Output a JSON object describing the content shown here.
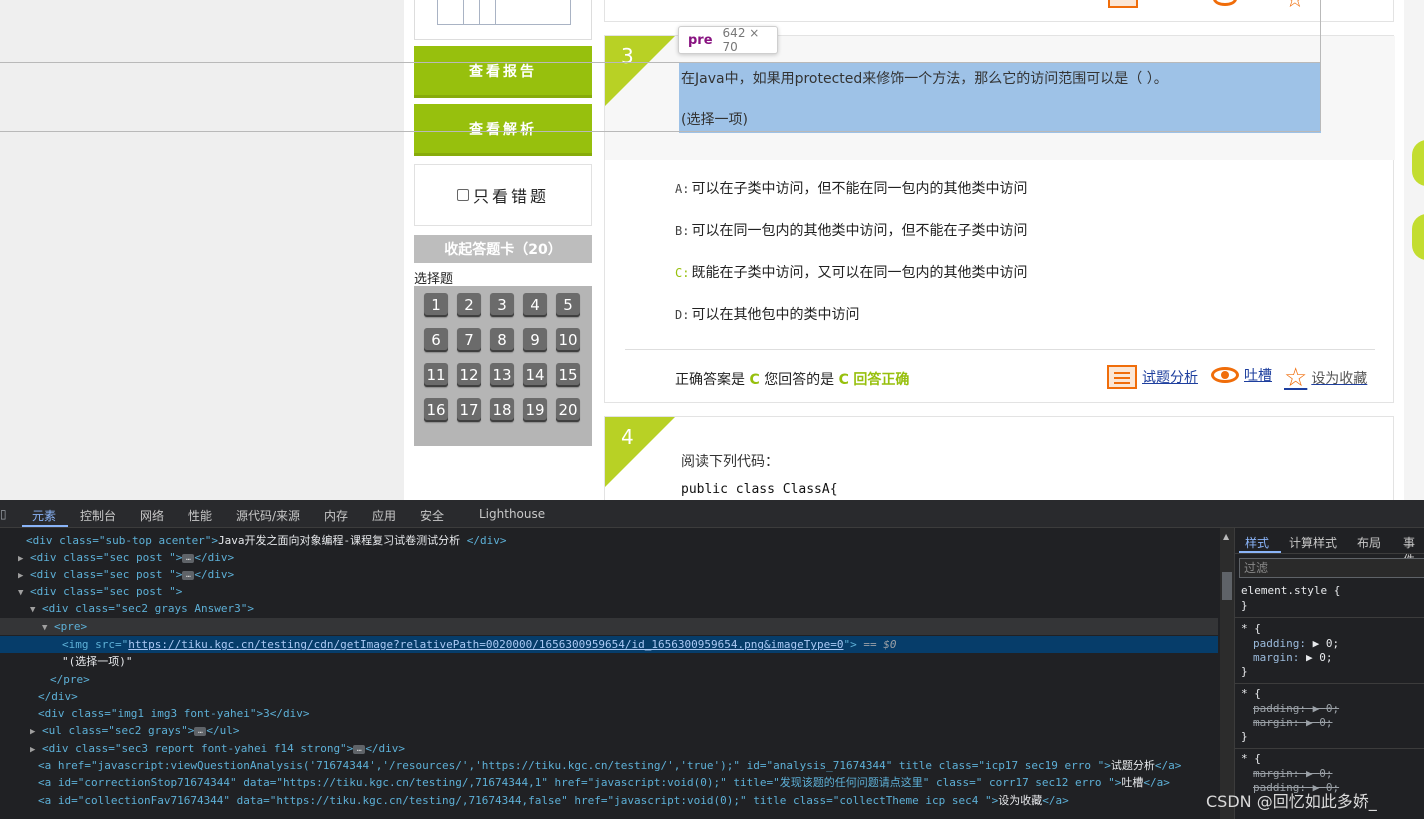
{
  "sidebar": {
    "view_report": "查看报告",
    "view_analysis": "查看解析",
    "only_wrong": "只看错题",
    "collapse_card": "收起答题卡（20）",
    "question_type": "选择题",
    "numbers": [
      "1",
      "2",
      "3",
      "4",
      "5",
      "6",
      "7",
      "8",
      "9",
      "10",
      "11",
      "12",
      "13",
      "14",
      "15",
      "16",
      "17",
      "18",
      "19",
      "20"
    ]
  },
  "inspector_tooltip": {
    "tag": "pre",
    "size": "642 × 70"
  },
  "question3": {
    "number": "3",
    "text": "在Java中，如果用protected来修饰一个方法，那么它的访问范围可以是（ ）。",
    "type_hint": "(选择一项)",
    "options": [
      {
        "key": "A:",
        "text": "可以在子类中访问，但不能在同一包内的其他类中访问"
      },
      {
        "key": "B:",
        "text": "可以在同一包内的其他类中访问，但不能在子类中访问"
      },
      {
        "key": "C:",
        "text": "既能在子类中访问，又可以在同一包内的其他类中访问"
      },
      {
        "key": "D:",
        "text": "可以在其他包中的类中访问"
      }
    ],
    "answer_prefix": "正确答案是",
    "correct_answer": "C",
    "your_answer_prefix": "您回答的是",
    "your_answer": "C",
    "result": "回答正确",
    "actions": {
      "analysis": "试题分析",
      "comment": "吐槽",
      "favorite": "设为收藏"
    }
  },
  "question4": {
    "number": "4",
    "text": "阅读下列代码：",
    "code": "public class ClassA{"
  },
  "devtools": {
    "tabs": [
      "元素",
      "控制台",
      "网络",
      "性能",
      "源代码/来源",
      "内存",
      "应用",
      "安全",
      "Lighthouse"
    ],
    "dom": {
      "l1_tag": "<div class=\"sub-top acenter\">",
      "l1_text": "Java开发之面向对象编程-课程复习试卷测试分析 ",
      "l1_close": "</div>",
      "sec_post": "<div class=\"sec post \">",
      "close_div": "</div>",
      "sec_post2": "<div class=\"sec post \">",
      "answer3": "<div class=\"sec2 grays Answer3\">",
      "pre_open": "<pre>",
      "img_open": "<img src=\"",
      "img_url": "https://tiku.kgc.cn/testing/cdn/getImage?relativePath=0020000/1656300959654/id_1656300959654.png&imageType=0",
      "img_close": "\">",
      "dollar": "== $0",
      "pre_text": "\"(选择一项)\"",
      "pre_close": "</pre>",
      "img1": "<div class=\"img1 img3 font-yahei\">3</div>",
      "ul": "<ul class=\"sec2 grays\">",
      "ul_close": "</ul>",
      "report": "<div class=\"sec3 report font-yahei f14 strong\">",
      "a1": "<a href=\"javascript:viewQuestionAnalysis('71674344','/resources/','https://tiku.kgc.cn/testing/','true');\" id=\"analysis_71674344\" title class=\"icp17  sec19 erro \">",
      "a1_text": "试题分析",
      "a2": "<a id=\"correctionStop71674344\" data=\"https://tiku.kgc.cn/testing/,71674344,1\" href=\"javascript:void(0);\" title=\"发现该题的任何问题请点这里\" class=\" corr17 sec12 erro \">",
      "a2_text": "吐槽",
      "a3": "<a id=\"collectionFav71674344\" data=\"https://tiku.kgc.cn/testing/,71674344,false\" href=\"javascript:void(0);\" title class=\"collectTheme icp sec4  \">",
      "a3_text": "设为收藏",
      "a_close": "</a>"
    },
    "styles_tabs": [
      "样式",
      "计算样式",
      "布局",
      "事件"
    ],
    "filter_placeholder": "过滤",
    "rules": {
      "element_style": "element.style {",
      "star": "* {",
      "close": "}",
      "padding": "padding:",
      "margin": "margin:",
      "zero": "0;"
    }
  },
  "watermark": "CSDN @回忆如此多娇_"
}
